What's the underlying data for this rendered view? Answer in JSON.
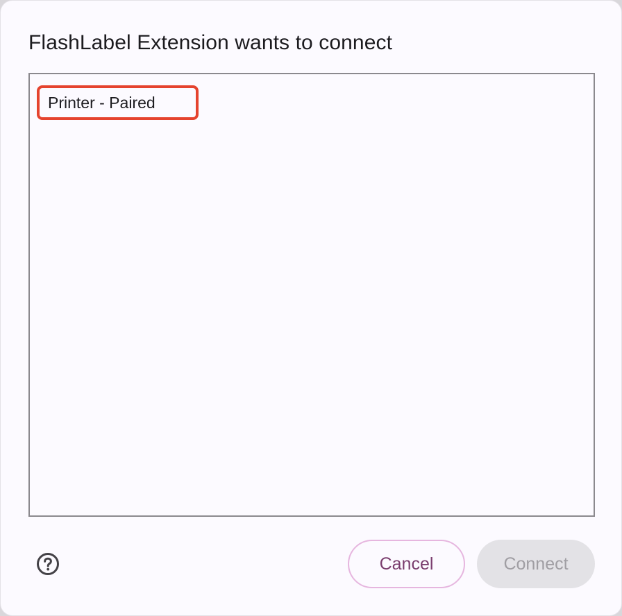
{
  "dialog": {
    "title": "FlashLabel Extension wants to connect"
  },
  "devices": [
    {
      "label": "Printer - Paired"
    }
  ],
  "footer": {
    "help_icon": "help-circle-icon",
    "cancel_label": "Cancel",
    "connect_label": "Connect"
  },
  "colors": {
    "accent": "#7a3d6e",
    "highlight": "#e5432e",
    "disabled_bg": "#e3e2e6",
    "disabled_text": "#a09ea3"
  }
}
